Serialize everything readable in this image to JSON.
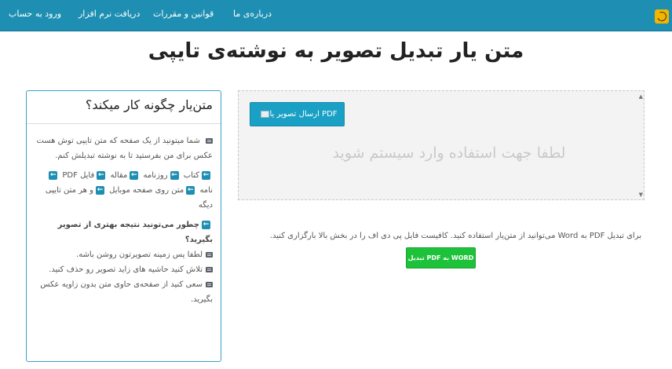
{
  "navbar": {
    "links": [
      {
        "label": "درباره‌ی ما",
        "name": "nav-about"
      },
      {
        "label": "قوانین و مقررات",
        "name": "nav-rules"
      },
      {
        "label": "دریافت نرم افزار",
        "name": "nav-download"
      },
      {
        "label": "ورود به حساب",
        "name": "nav-login"
      }
    ],
    "logo_icon": "smiley-logo-icon"
  },
  "page": {
    "title": "متن یار تبدیل تصویر به نوشته‌ی تایپی"
  },
  "info_panel": {
    "heading": "متن‌یار چگونه کار میکند؟",
    "intro": "شما میتونید از یک صفحه که متن تایپی توش هست عکس برای من بفرستید تا به نوشته تبدیلش کنم.",
    "sources": [
      "کتاب",
      "روزنامه",
      "مقاله",
      "فایل PDF",
      "نامه",
      "متن روی صفحه موبایل",
      "و هر متن تایپی دیگه"
    ],
    "tips_heading": "چطور می‌تونید نتیجه بهتری از تصویر بگیرید؟",
    "tips": [
      "لطفا پس زمینه تصویرتون روشن باشه.",
      "تلاش کنید حاشیه های زاید تصویر رو حذف کنید.",
      "سعی کنید از صفحه‌ی حاوی متن بدون زاویه عکس بگیرید."
    ]
  },
  "upload": {
    "button_label": "ارسال تصویر یا PDF",
    "hint": "لطفا جهت استفاده وارد سیستم شوید"
  },
  "pdf_section": {
    "note": "برای تبدیل PDF به Word می‌توانید از متن‌یار استفاده کنید. کافیست فایل پی دی اف را در بخش بالا بارگزاری کنید.",
    "button_label": "تبدیل PDF به WORD"
  },
  "colors": {
    "navbar": "#1e8fb2",
    "primary_button": "#1aa0c4",
    "success_button": "#1ec23a",
    "panel_border": "#3ca0c8"
  }
}
